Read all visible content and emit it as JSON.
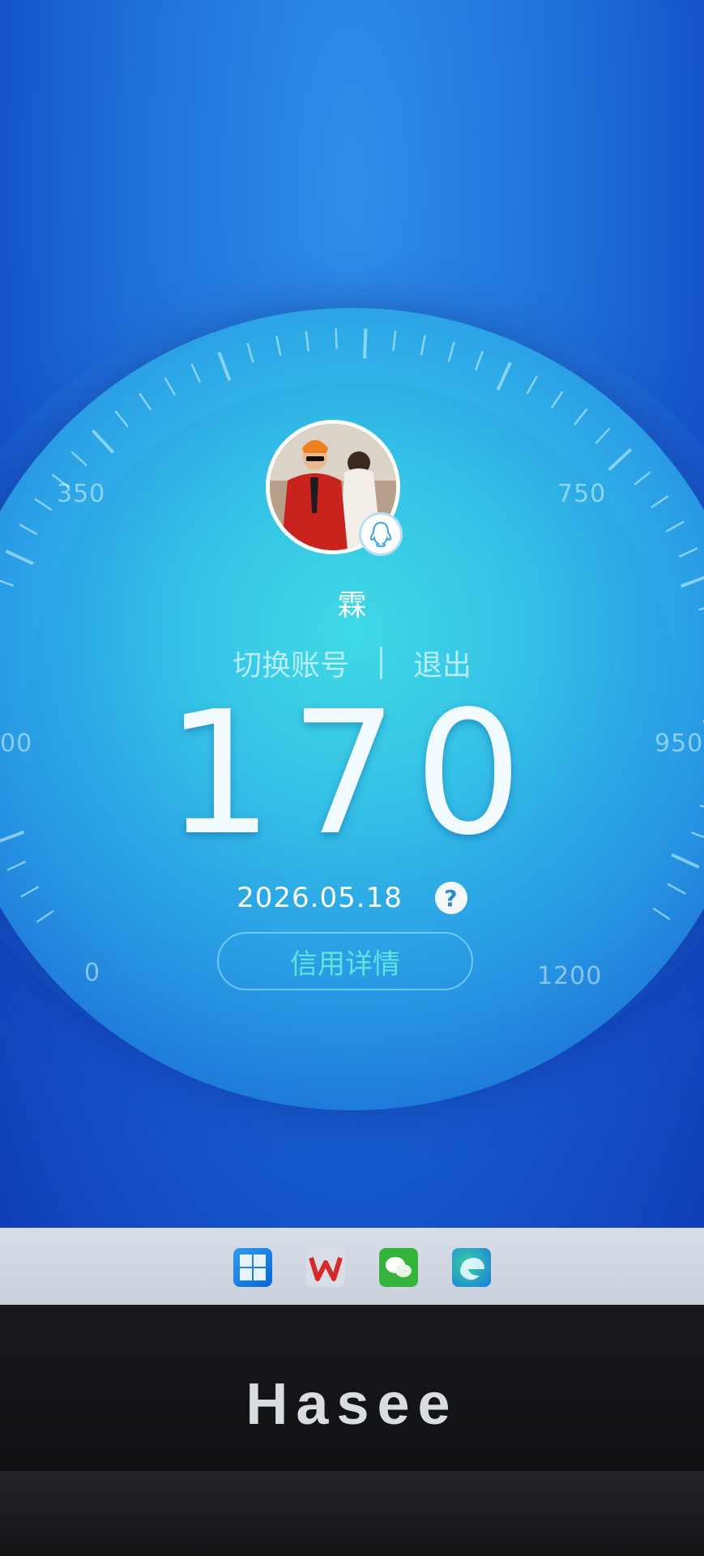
{
  "gauge": {
    "scale_labels": [
      "350",
      "750",
      "00",
      "950",
      "0",
      "1200"
    ]
  },
  "profile": {
    "username": "霖",
    "switch_account": "切换账号",
    "logout": "退出"
  },
  "score": {
    "value": "170",
    "date": "2026.05.18",
    "help_glyph": "?",
    "detail_button": "信用详情"
  },
  "taskbar": {
    "icons": [
      "windows-start-icon",
      "wps-icon",
      "wechat-icon",
      "edge-browser-icon"
    ]
  },
  "monitor": {
    "brand": "Hasee"
  },
  "colors": {
    "accent_cyan": "#5fe3e0",
    "gauge_light": "#43dbe6",
    "screen_blue": "#1f6fd8"
  }
}
